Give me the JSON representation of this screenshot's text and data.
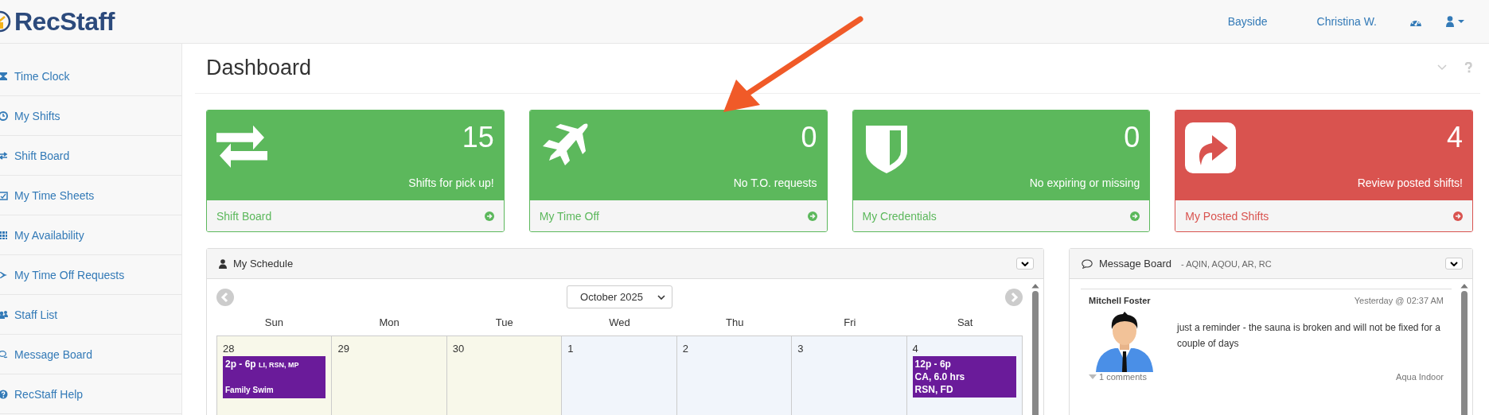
{
  "header": {
    "logo": "RecStaff",
    "nav": [
      "Bayside",
      "Christina W."
    ]
  },
  "sidebar": {
    "items": [
      "Time Clock",
      "My Shifts",
      "Shift Board",
      "My Time Sheets",
      "My Availability",
      "My Time Off Requests",
      "Staff List",
      "Message Board",
      "RecStaff Help"
    ]
  },
  "page": {
    "title": "Dashboard"
  },
  "cards": [
    {
      "count": "15",
      "caption": "Shifts for pick up!",
      "link": "Shift Board",
      "color": "#5cb85c"
    },
    {
      "count": "0",
      "caption": "No T.O. requests",
      "link": "My Time Off",
      "color": "#5cb85c"
    },
    {
      "count": "0",
      "caption": "No expiring or missing",
      "link": "My Credentials",
      "color": "#5cb85c"
    },
    {
      "count": "4",
      "caption": "Review posted shifts!",
      "link": "My Posted Shifts",
      "color": "#d9534f"
    }
  ],
  "schedule": {
    "title": "My Schedule",
    "month": "October 2025",
    "weekdays": [
      "Sun",
      "Mon",
      "Tue",
      "Wed",
      "Thu",
      "Fri",
      "Sat"
    ],
    "days": [
      {
        "date": "28",
        "other_month": true,
        "events": [
          {
            "kind": "class",
            "time": "2p - 6p",
            "tags": "LI, RSN, MP",
            "title": "Family Swim"
          }
        ]
      },
      {
        "date": "29",
        "other_month": true
      },
      {
        "date": "30",
        "other_month": true
      },
      {
        "date": "1",
        "other_month": false
      },
      {
        "date": "2",
        "other_month": false
      },
      {
        "date": "3",
        "other_month": false
      },
      {
        "date": "4",
        "other_month": false,
        "events": [
          {
            "kind": "shift",
            "time": "12p - 6p",
            "lines": [
              "CA, 6.0 hrs",
              "RSN, FD"
            ]
          }
        ]
      }
    ]
  },
  "message_board": {
    "title": "Message Board",
    "groups": "- AQIN, AQOU, AR, RC",
    "posts": [
      {
        "author": "Mitchell Foster",
        "time": "Yesterday @ 02:37 AM",
        "text": "just a reminder - the sauna is broken and will not be fixed for a couple of days",
        "comments": "1 comments",
        "location": "Aqua Indoor"
      }
    ]
  }
}
